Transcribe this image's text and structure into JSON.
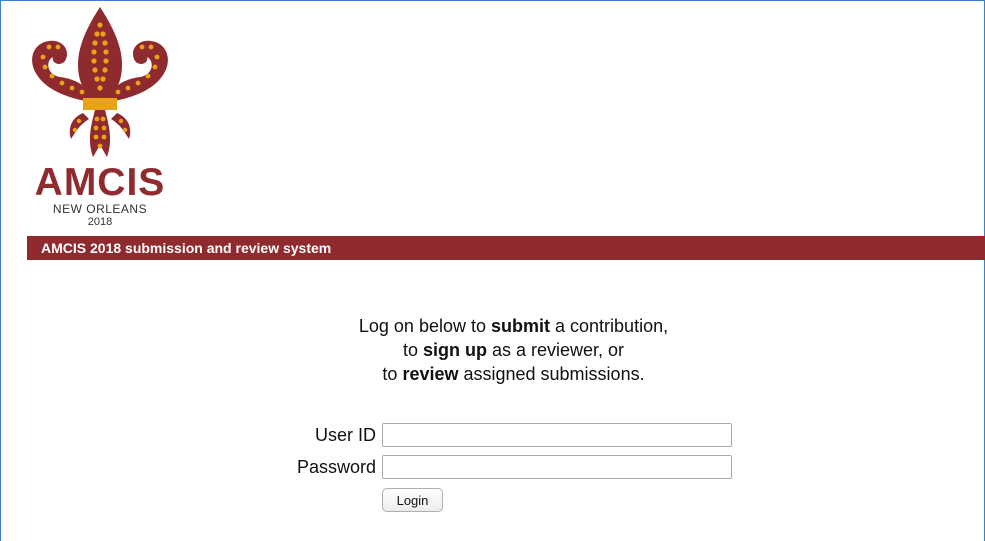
{
  "logo": {
    "brand": "AMCIS",
    "city": "NEW ORLEANS",
    "year": "2018",
    "icon": "fleur-de-lis-icon"
  },
  "banner": {
    "title": "AMCIS 2018 submission and review system"
  },
  "intro": {
    "line1_prefix": "Log on below to ",
    "line1_bold": "submit",
    "line1_suffix": " a contribution,",
    "line2_prefix": "to ",
    "line2_bold": "sign up",
    "line2_suffix": " as a reviewer, or",
    "line3_prefix": "to ",
    "line3_bold": "review",
    "line3_suffix": " assigned submissions."
  },
  "form": {
    "user_id_label": "User ID",
    "user_id_value": "",
    "password_label": "Password",
    "password_value": "",
    "login_label": "Login"
  },
  "colors": {
    "brand": "#8f2a2e",
    "gold": "#e8a317",
    "frame": "#3a7fd0"
  }
}
